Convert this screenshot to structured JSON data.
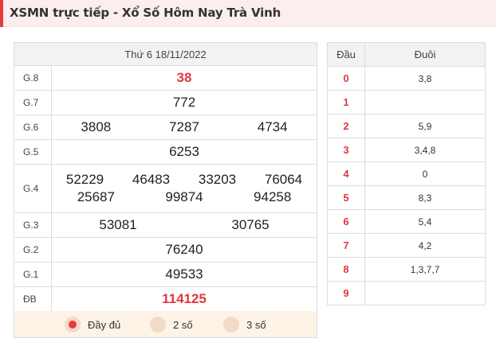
{
  "header": {
    "title": "XSMN trực tiếp - Xổ Số Hôm Nay Trà Vinh"
  },
  "results": {
    "date": "Thứ 6 18/11/2022",
    "prizes": [
      {
        "label": "G.8",
        "values": [
          "38"
        ],
        "highlight": true
      },
      {
        "label": "G.7",
        "values": [
          "772"
        ]
      },
      {
        "label": "G.6",
        "values": [
          "3808",
          "7287",
          "4734"
        ]
      },
      {
        "label": "G.5",
        "values": [
          "6253"
        ]
      },
      {
        "label": "G.4",
        "values": [
          "52229",
          "46483",
          "33203",
          "76064",
          "25687",
          "99874",
          "94258"
        ]
      },
      {
        "label": "G.3",
        "values": [
          "53081",
          "30765"
        ]
      },
      {
        "label": "G.2",
        "values": [
          "76240"
        ]
      },
      {
        "label": "G.1",
        "values": [
          "49533"
        ]
      },
      {
        "label": "ĐB",
        "values": [
          "114125"
        ],
        "highlight": true
      }
    ]
  },
  "display_options": {
    "selected": "full",
    "full": "Đầy đủ",
    "two": "2 số",
    "three": "3 số"
  },
  "lotto": {
    "head_label": "Đầu",
    "tail_label": "Đuôi",
    "rows": [
      {
        "head": "0",
        "tail": "3,8"
      },
      {
        "head": "1",
        "tail": ""
      },
      {
        "head": "2",
        "tail": "5,9"
      },
      {
        "head": "3",
        "tail": "3,4,8"
      },
      {
        "head": "4",
        "tail": "0"
      },
      {
        "head": "5",
        "tail": "8,3"
      },
      {
        "head": "6",
        "tail": "5,4"
      },
      {
        "head": "7",
        "tail": "4,2"
      },
      {
        "head": "8",
        "tail": "1,3,7,7"
      },
      {
        "head": "9",
        "tail": ""
      }
    ]
  },
  "colors": {
    "accent": "#e43b3b",
    "prize_highlight": "#e0383e",
    "header_bg": "#fdeeee",
    "options_bg": "#fdf3e6"
  }
}
